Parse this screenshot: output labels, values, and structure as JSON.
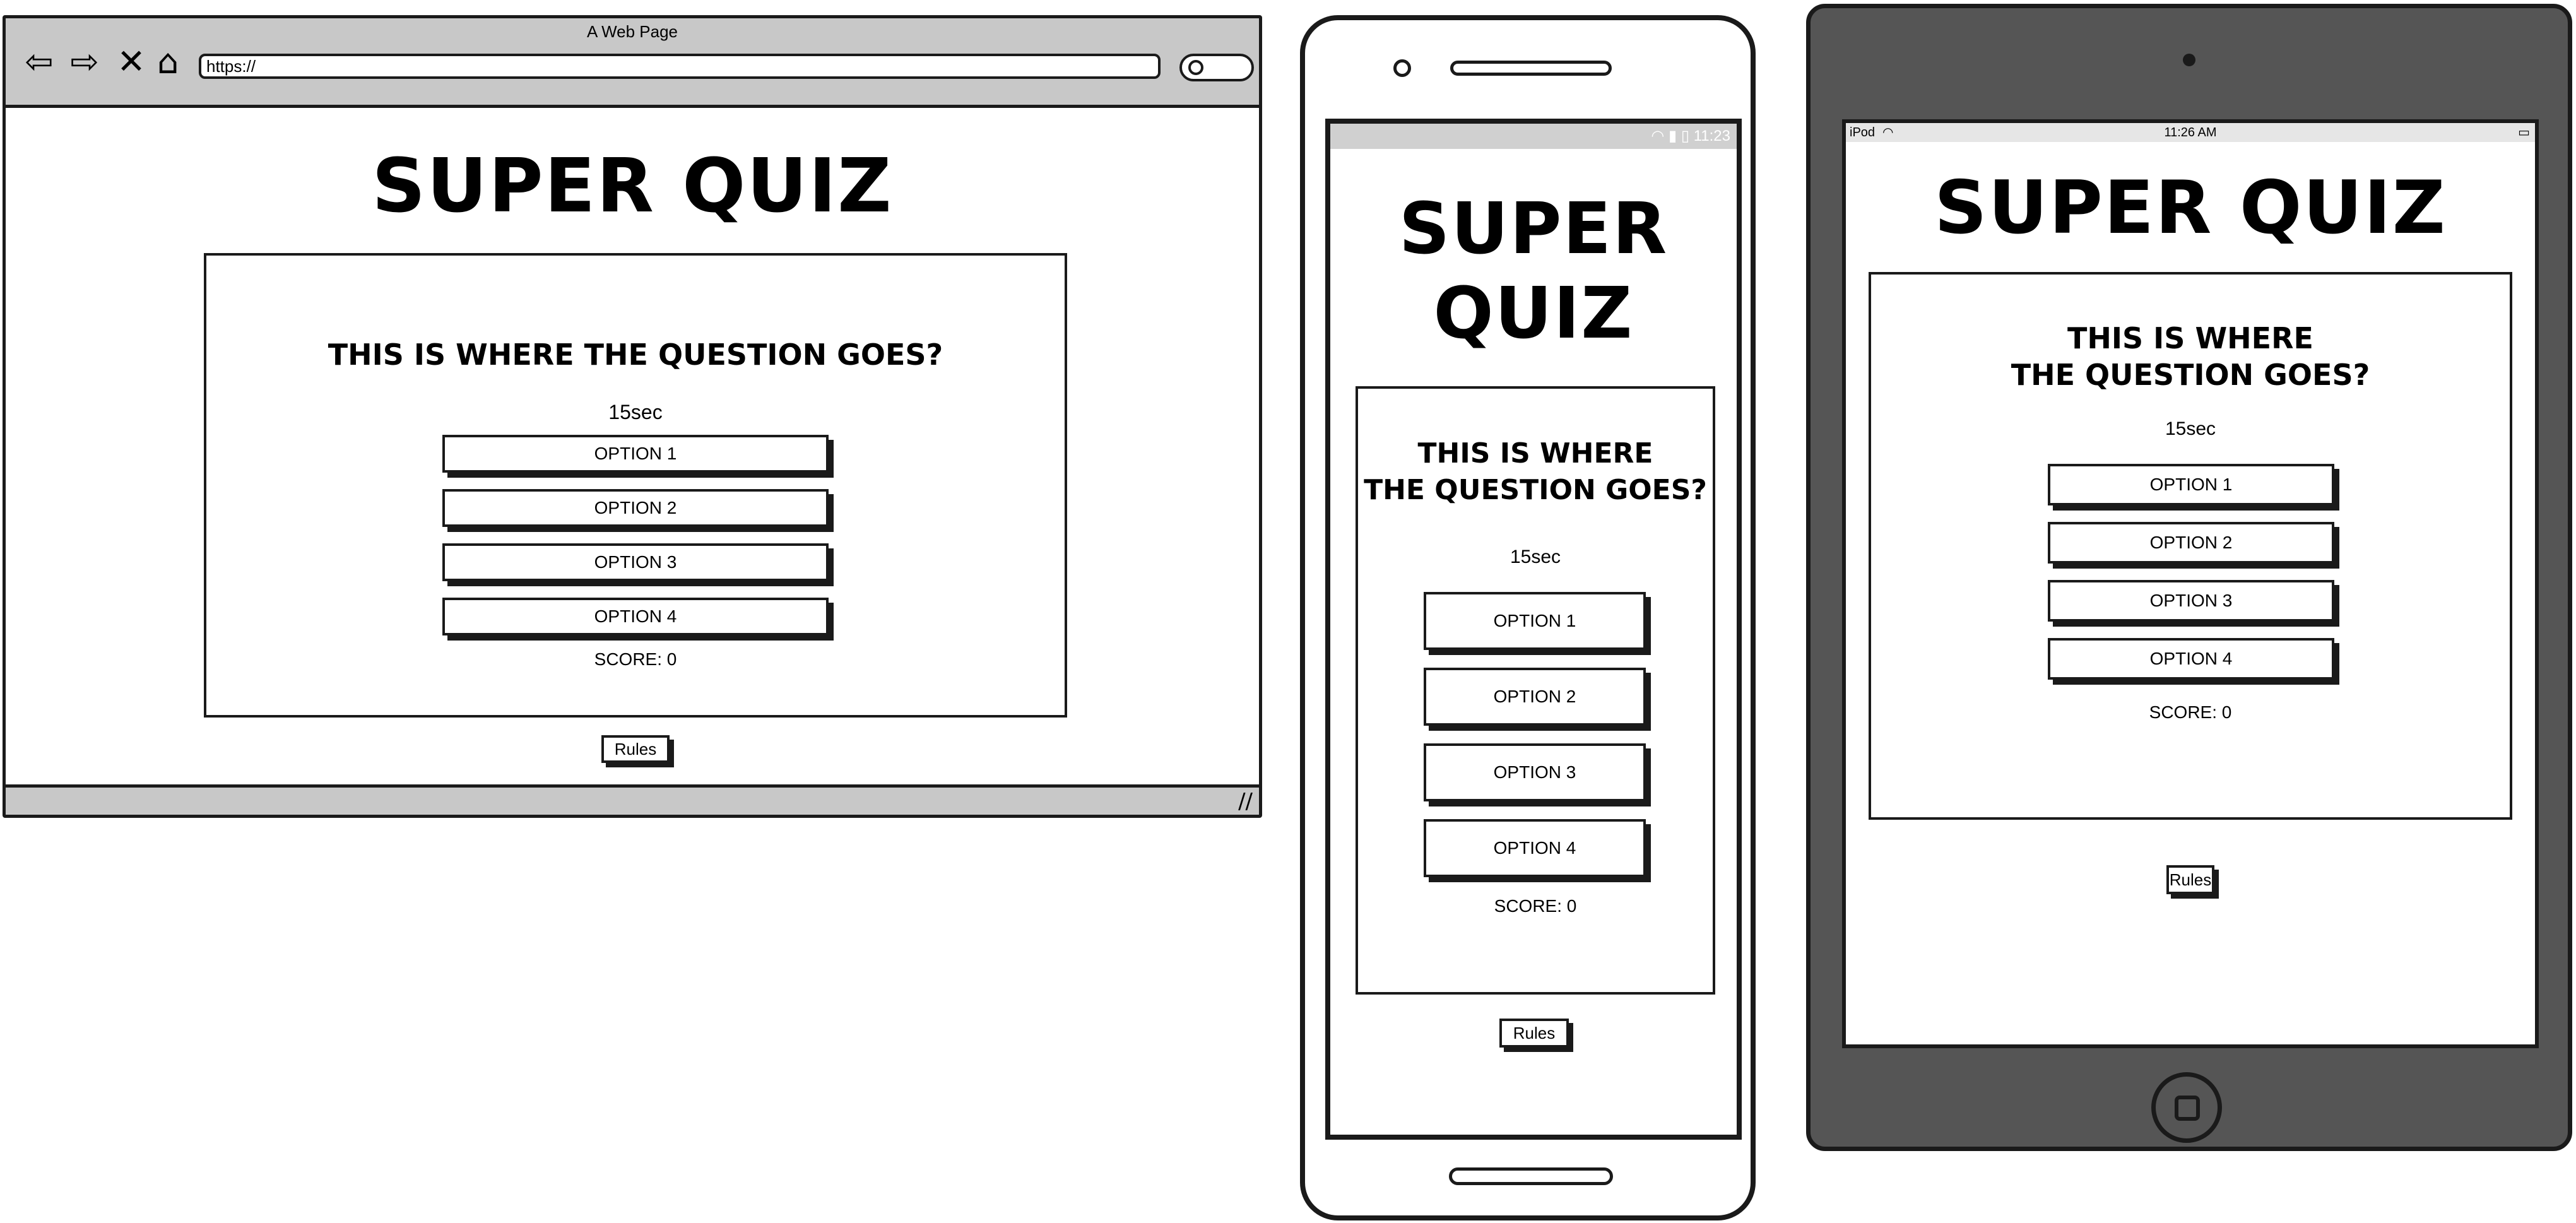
{
  "desktop": {
    "window_title": "A Web Page",
    "url": "https://",
    "nav_icons": [
      "back-arrow-icon",
      "forward-arrow-icon",
      "close-x-icon",
      "home-icon"
    ],
    "quiz": {
      "title": "SUPER QUIZ",
      "question": "THIS IS WHERE THE QUESTION GOES?",
      "timer": "15sec",
      "options": [
        "OPTION 1",
        "OPTION 2",
        "OPTION 3",
        "OPTION 4"
      ],
      "score": "SCORE: 0",
      "rules_label": "Rules"
    }
  },
  "phone": {
    "status_time": "11:23",
    "quiz": {
      "title_line1": "SUPER",
      "title_line2": "QUIZ",
      "question_line1": "THIS IS WHERE",
      "question_line2": "THE QUESTION GOES?",
      "timer": "15sec",
      "options": [
        "OPTION 1",
        "OPTION 2",
        "OPTION 3",
        "OPTION 4"
      ],
      "score": "SCORE: 0",
      "rules_label": "Rules"
    }
  },
  "tablet": {
    "status_device": "iPod",
    "status_time": "11:26 AM",
    "quiz": {
      "title": "SUPER QUIZ",
      "question_line1": "THIS IS WHERE",
      "question_line2": "THE QUESTION GOES?",
      "timer": "15sec",
      "options": [
        "OPTION 1",
        "OPTION 2",
        "OPTION 3",
        "OPTION 4"
      ],
      "score": "SCORE: 0",
      "rules_label": "Rules"
    }
  },
  "colors": {
    "frame": "#1a1a1a",
    "browser_chrome": "#c8c8c8",
    "tablet_body": "#555555",
    "phone_status_bar": "#d0d0d0",
    "background": "#ffffff"
  }
}
